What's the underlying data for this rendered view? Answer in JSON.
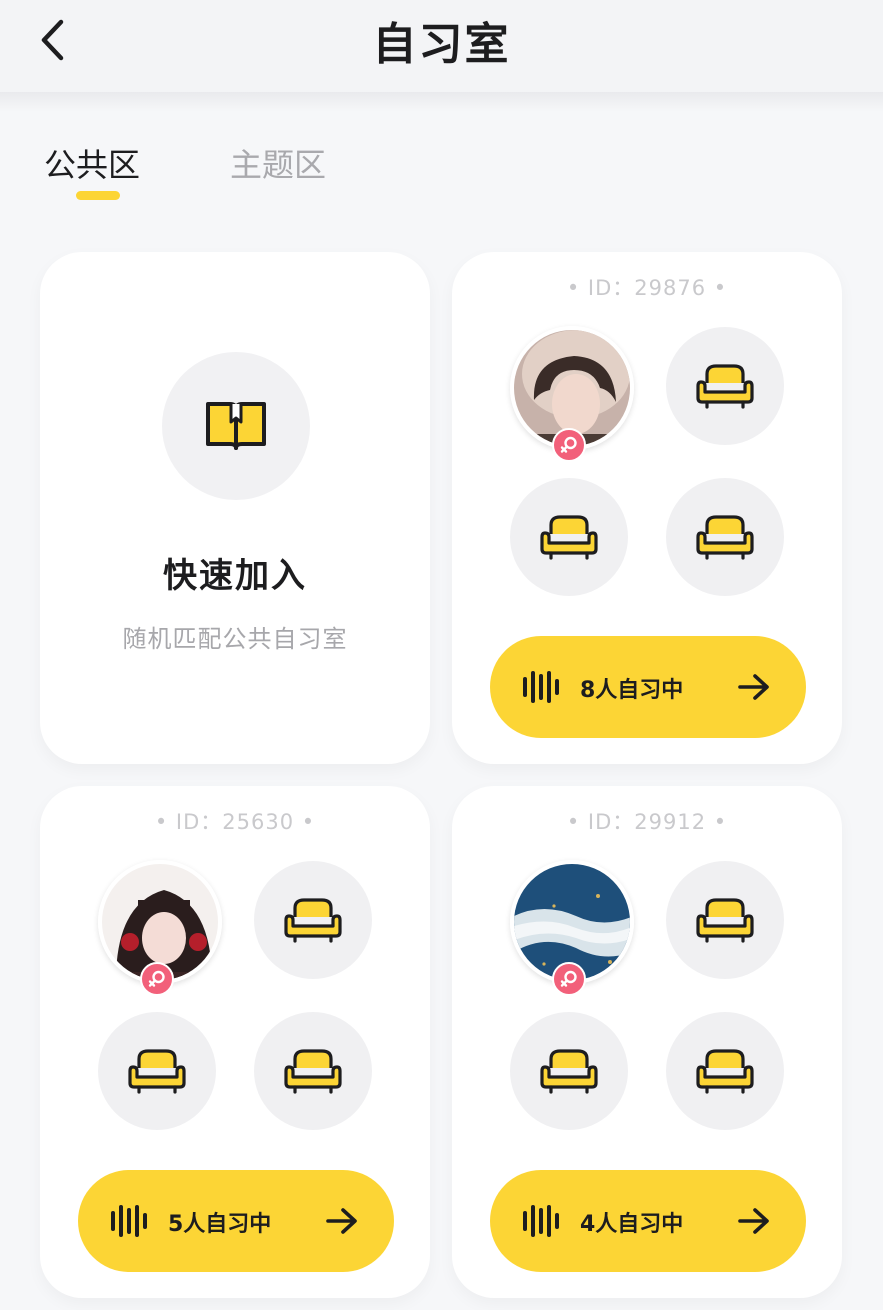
{
  "header": {
    "title": "自习室",
    "back_icon": "chevron-left-icon"
  },
  "tabs": [
    {
      "label": "公共区",
      "active": true
    },
    {
      "label": "主题区",
      "active": false
    }
  ],
  "quick_join": {
    "title": "快速加入",
    "subtitle": "随机匹配公共自习室",
    "icon": "open-book-icon"
  },
  "rooms": [
    {
      "id_text": "•  ID：29876  •",
      "join_label": "8人自习中",
      "occupant_gender": "female"
    },
    {
      "id_text": "•  ID：25630  •",
      "join_label": "5人自习中",
      "occupant_gender": "female"
    },
    {
      "id_text": "•  ID：29912  •",
      "join_label": "4人自习中",
      "occupant_gender": "female"
    }
  ],
  "colors": {
    "accent": "#fcd535",
    "female_badge": "#f2607a",
    "background": "#f6f7f9",
    "text_primary": "#1d1d1f",
    "text_muted": "#a7a7ab"
  }
}
